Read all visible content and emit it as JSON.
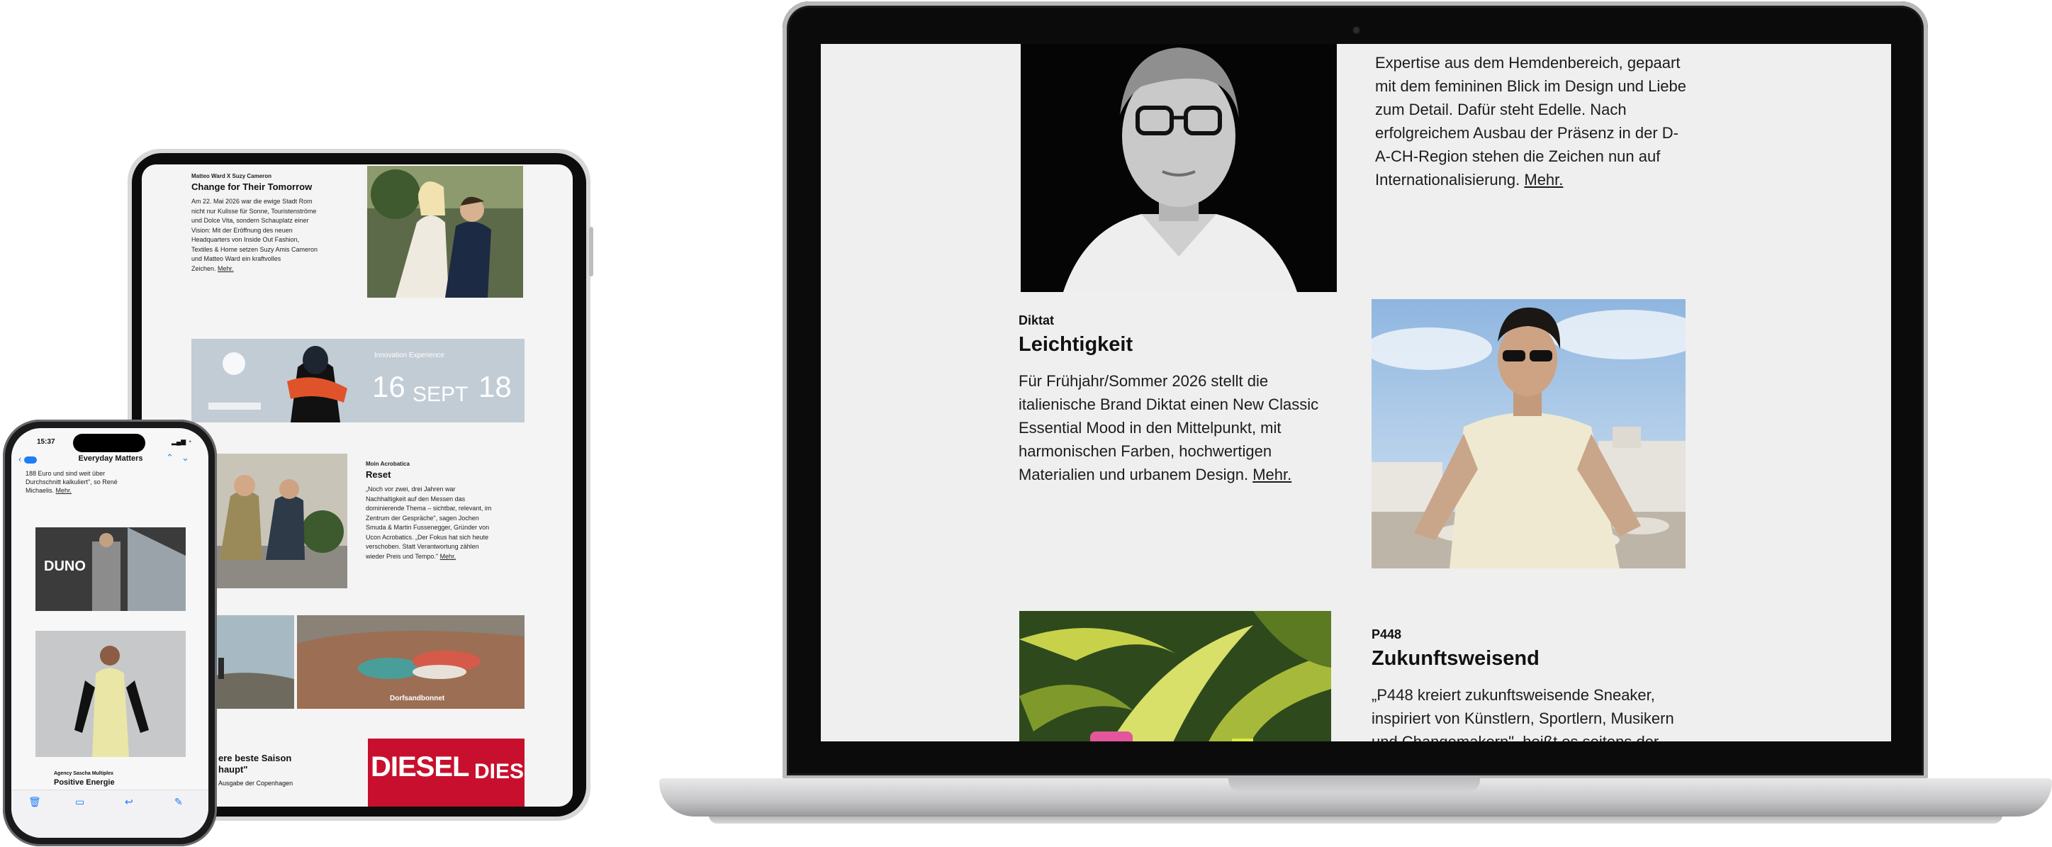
{
  "colors": {
    "laptop_screen_bg": "#efefef",
    "link_blue": "#1e7cf7",
    "diesel_red": "#c8102e",
    "event_banner": "#bfcad3"
  },
  "laptop": {
    "article1": {
      "text_lines": [
        "Expertise aus dem Hemdenbereich, gepaart",
        "mit dem femininen Blick im Design und Liebe",
        "zum Detail. Dafür steht Edelle. Nach",
        "erfolgreichem Ausbau der Präsenz in der D-",
        "A-CH-Region stehen die Zeichen nun auf"
      ],
      "last_line": "Internationalisierung.",
      "more": "Mehr."
    },
    "article2": {
      "brand": "Diktat",
      "title": "Leichtigkeit",
      "text_lines": [
        "Für Frühjahr/Sommer 2026 stellt die",
        "italienische Brand Diktat einen New Classic",
        "Essential Mood in den Mittelpunkt, mit",
        "harmonischen Farben, hochwertigen"
      ],
      "last_line": "Materialien und urbanem Design.",
      "more": "Mehr."
    },
    "article3": {
      "brand": "P448",
      "title": "Zukunftsweisend",
      "text_lines": [
        "„P448 kreiert zukunftsweisende Sneaker,",
        "inspiriert von Künstlern, Sportlern, Musikern",
        "und Changemakern\", heißt es seitens der"
      ]
    }
  },
  "tablet": {
    "article1": {
      "brand": "Matteo Ward X Suzy Cameron",
      "title": "Change for Their Tomorrow",
      "text_lines": [
        "Am 22. Mai 2026 war die ewige Stadt Rom",
        "nicht nur Kulisse für Sonne, Touristenströme",
        "und Dolce Vita, sondern Schauplatz einer",
        "Vision: Mit der Eröffnung des neuen",
        "Headquarters von Inside Out Fashion,",
        "Textiles & Home setzen Suzy Amis Cameron",
        "und Matteo Ward ein kraftvolles",
        "Zeichen."
      ],
      "more": "Mehr."
    },
    "banner": {
      "label": "Innovation Experience",
      "date_start": "16",
      "month": "SEPT",
      "date_end": "18"
    },
    "article2": {
      "brand": "Moin Acrobatica",
      "title": "Reset",
      "text_lines": [
        "„Noch vor zwei, drei Jahren war",
        "Nachhaltigkeit auf den Messen das",
        "dominierende Thema – sichtbar, relevant, im",
        "Zentrum der Gespräche\", sagen Jochen",
        "Smuda & Martin Fussenegger, Gründer von",
        "Ucon Acrobatics. „Der Fokus hat sich heute",
        "verschoben. Statt Verantwortung zählen",
        "wieder Preis und Tempo.\""
      ],
      "more": "Mehr."
    },
    "sneaker_caption": "Dorfsandbonnet",
    "diesel": "DIESEL"
  },
  "phone": {
    "time": "15:37",
    "mail_title": "Everyday Matters",
    "intro_lines": [
      "188 Euro und sind weit über",
      "Durchschnitt kalkuliert\", so René",
      "Michaelis."
    ],
    "intro_more": "Mehr.",
    "store_sign": "DUNO",
    "article": {
      "brand": "Agency Sascha Multiplex",
      "title": "Positive Energie"
    },
    "peek_title_1": "ere beste Saison",
    "peek_title_2": "haupt\"",
    "peek_text": "Ausgabe der Copenhagen"
  }
}
